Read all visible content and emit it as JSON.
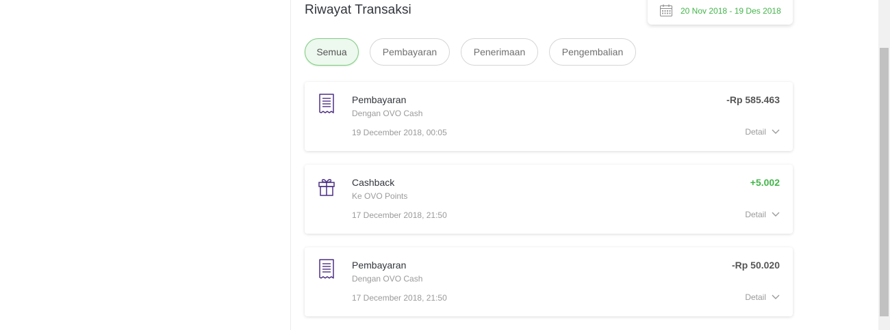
{
  "page": {
    "title": "Riwayat Transaksi",
    "date_range": "20 Nov 2018 - 19 Des 2018"
  },
  "filters": [
    {
      "label": "Semua",
      "active": true
    },
    {
      "label": "Pembayaran",
      "active": false
    },
    {
      "label": "Penerimaan",
      "active": false
    },
    {
      "label": "Pengembalian",
      "active": false
    }
  ],
  "transactions": [
    {
      "icon": "receipt-icon",
      "title": "Pembayaran",
      "subtitle": "Dengan OVO Cash",
      "datetime": "19 December 2018, 00:05",
      "amount": "-Rp 585.463",
      "detail_label": "Detail"
    },
    {
      "icon": "gift-icon",
      "title": "Cashback",
      "subtitle": "Ke OVO Points",
      "datetime": "17 December 2018, 21:50",
      "amount": "+5.002",
      "detail_label": "Detail"
    },
    {
      "icon": "receipt-icon",
      "title": "Pembayaran",
      "subtitle": "Dengan OVO Cash",
      "datetime": "17 December 2018, 21:50",
      "amount": "-Rp 50.020",
      "detail_label": "Detail"
    }
  ],
  "colors": {
    "accent_green": "#42b549",
    "icon_purple": "#4b2e83"
  }
}
